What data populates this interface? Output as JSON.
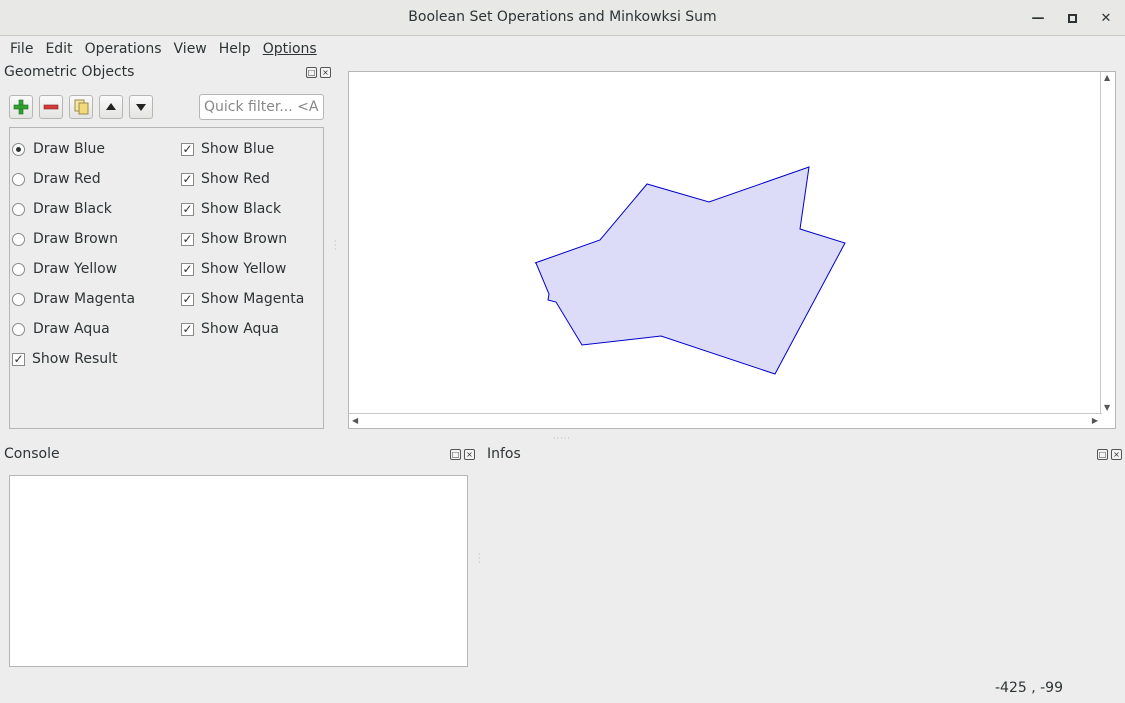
{
  "window": {
    "title": "Boolean Set Operations and Minkowksi Sum"
  },
  "menu": {
    "items": [
      "File",
      "Edit",
      "Operations",
      "View",
      "Help",
      "Options"
    ]
  },
  "geometric_objects": {
    "title": "Geometric Objects",
    "filter_placeholder": "Quick filter... <Al...",
    "draw_options": [
      {
        "label": "Draw Blue",
        "selected": true
      },
      {
        "label": "Draw Red",
        "selected": false
      },
      {
        "label": "Draw Black",
        "selected": false
      },
      {
        "label": "Draw Brown",
        "selected": false
      },
      {
        "label": "Draw Yellow",
        "selected": false
      },
      {
        "label": "Draw Magenta",
        "selected": false
      },
      {
        "label": "Draw Aqua",
        "selected": false
      }
    ],
    "show_options": [
      {
        "label": "Show Blue",
        "checked": true
      },
      {
        "label": "Show Red",
        "checked": true
      },
      {
        "label": "Show Black",
        "checked": true
      },
      {
        "label": "Show Brown",
        "checked": true
      },
      {
        "label": "Show Yellow",
        "checked": true
      },
      {
        "label": "Show Magenta",
        "checked": true
      },
      {
        "label": "Show Aqua",
        "checked": true
      }
    ],
    "show_result": {
      "label": "Show Result",
      "checked": true
    }
  },
  "console": {
    "title": "Console"
  },
  "infos": {
    "title": "Infos"
  },
  "status": {
    "coordinates": "-425 , -99"
  },
  "colors": {
    "polygon_stroke": "#0000cc",
    "polygon_fill": "#dcdcf8",
    "add_icon": "#2ea32e",
    "remove_icon": "#d43a3a"
  }
}
